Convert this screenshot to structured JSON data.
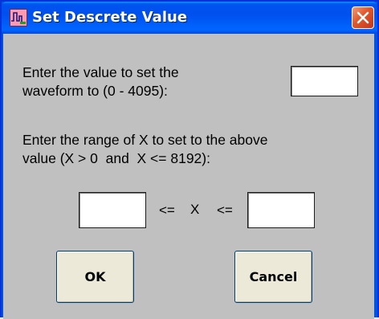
{
  "window": {
    "title": "Set Descrete Value",
    "icon": "waveform-app-icon",
    "close_icon": "close-icon"
  },
  "value_prompt": {
    "line1": "Enter the value to set the",
    "line2": "waveform to (0 - 4095):",
    "input_value": ""
  },
  "range_prompt": {
    "line1": "Enter the range of X to set to the above",
    "line2": "value (X > 0  and  X <= 8192):"
  },
  "range": {
    "min_value": "",
    "max_value": "",
    "left_op": "<=",
    "variable": "X",
    "right_op": "<="
  },
  "buttons": {
    "ok_label": "OK",
    "cancel_label": "Cancel"
  },
  "colors": {
    "titlebar": "#0054e3",
    "close_button": "#e0562a",
    "dialog_background": "#c0c0c0",
    "button_face": "#ece9d8"
  }
}
